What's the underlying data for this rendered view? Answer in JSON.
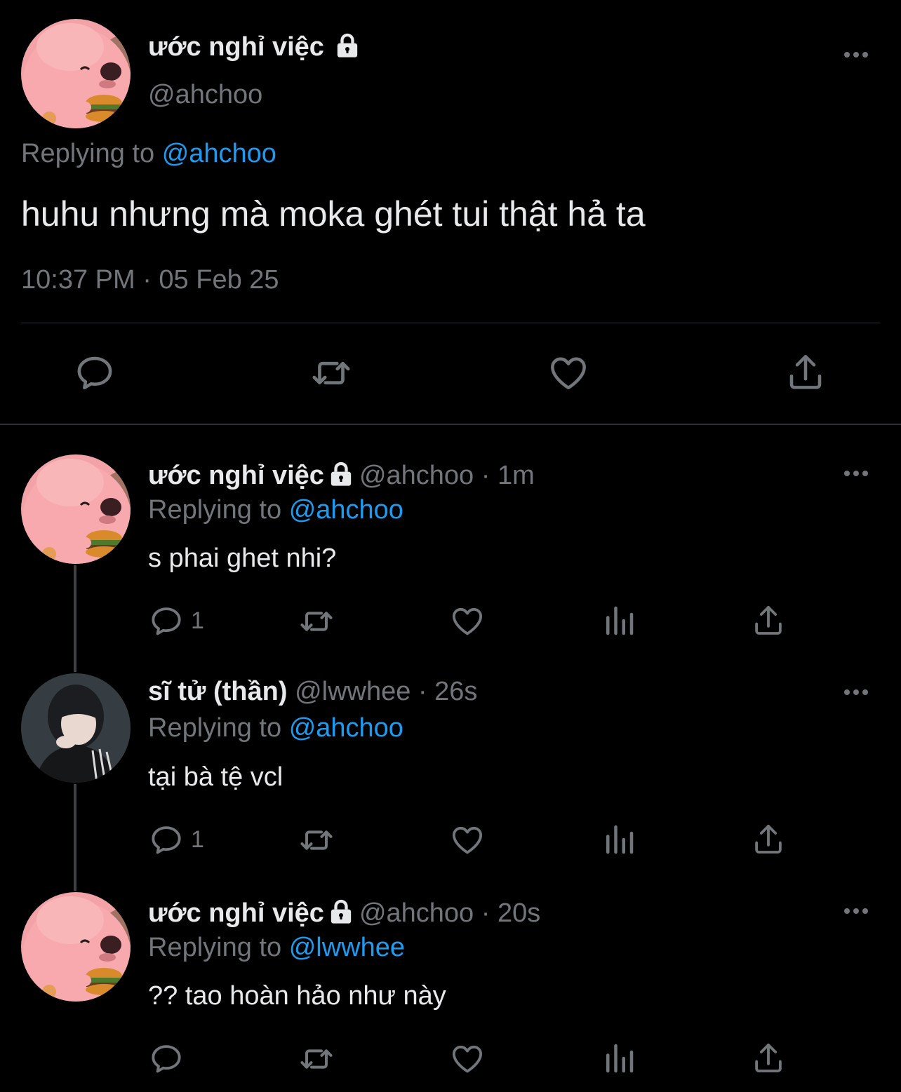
{
  "main_tweet": {
    "display_name": "ước nghỉ việc",
    "handle": "@ahchoo",
    "replying_prefix": "Replying to",
    "replying_to": "@ahchoo",
    "text": "huhu nhưng mà moka ghét tui thật hả ta",
    "timestamp": "10:37 PM · 05 Feb 25"
  },
  "replies": [
    {
      "display_name": "ước nghỉ việc",
      "meta": "@ahchoo · 1m",
      "replying_prefix": "Replying to",
      "replying_to": "@ahchoo",
      "text": "s phai ghet nhi?",
      "reply_count": "1"
    },
    {
      "display_name": "sĩ tử (thần)",
      "meta": "@lwwhee · 26s",
      "replying_prefix": "Replying to",
      "replying_to": "@ahchoo",
      "text": "tại bà tệ vcl",
      "reply_count": "1"
    },
    {
      "display_name": "ước nghỉ việc",
      "meta": "@ahchoo · 20s",
      "replying_prefix": "Replying to",
      "replying_to": "@lwwhee",
      "text": "?? tao hoàn hảo như này",
      "reply_count": ""
    }
  ],
  "colors": {
    "background": "#000000",
    "text": "#e7e9ea",
    "muted": "#71767b",
    "accent": "#1d9bf0",
    "divider": "#2f3336"
  },
  "icons": [
    "lock-icon",
    "more-icon",
    "reply-icon",
    "retweet-icon",
    "like-icon",
    "views-icon",
    "share-icon"
  ]
}
